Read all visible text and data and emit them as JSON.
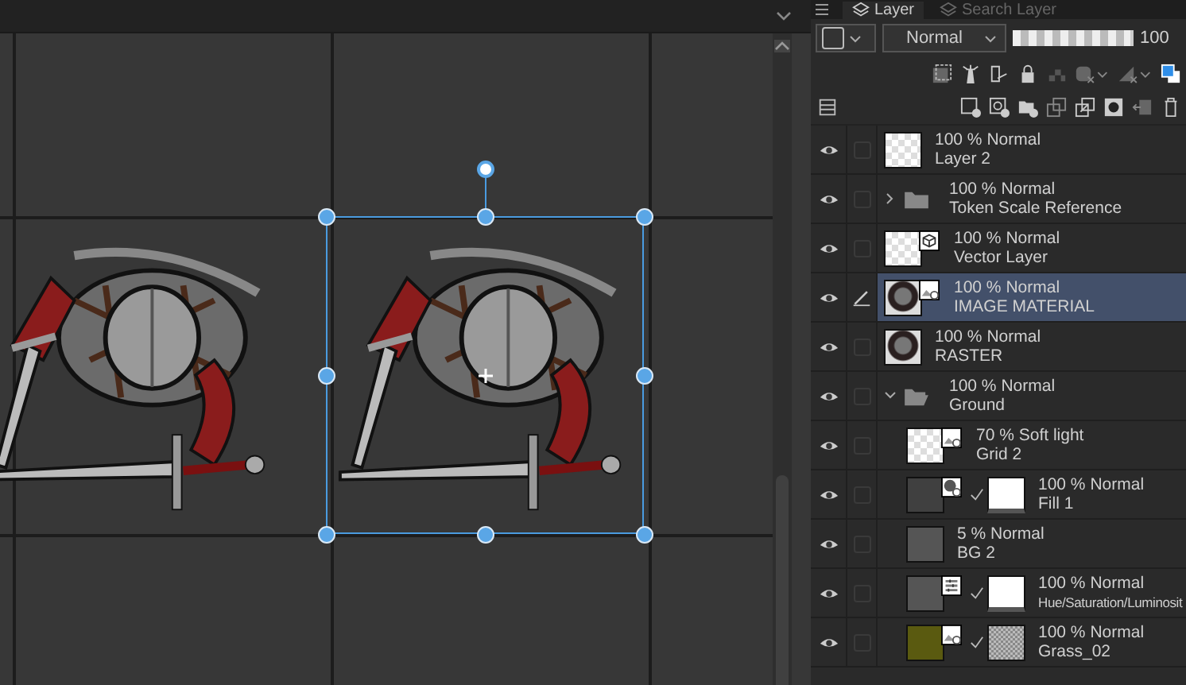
{
  "panel": {
    "tabs": [
      {
        "label": "Layer",
        "selected": true
      },
      {
        "label": "Search Layer",
        "selected": false
      }
    ],
    "blend_mode": "Normal",
    "opacity": {
      "level": 1.0,
      "reading": "100"
    },
    "layers": [
      {
        "kind": "raster",
        "thumb": {
          "kind": "checker"
        },
        "opacity_mode": "100 % Normal",
        "name": "Layer 2",
        "visible": true,
        "selected": false
      },
      {
        "kind": "folder",
        "opacity_mode": "100 % Normal",
        "name": "Token Scale Reference",
        "visible": true,
        "selected": false,
        "expanded": false
      },
      {
        "kind": "vector",
        "thumb": {
          "kind": "checker"
        },
        "opacity_mode": "100 % Normal",
        "name": "Vector Layer",
        "visible": true,
        "selected": false
      },
      {
        "kind": "material",
        "thumb": {
          "kind": "art"
        },
        "opacity_mode": "100 % Normal",
        "name": "IMAGE MATERIAL",
        "visible": true,
        "selected": true
      },
      {
        "kind": "raster",
        "thumb": {
          "kind": "art"
        },
        "opacity_mode": "100 % Normal",
        "name": "RASTER",
        "visible": true,
        "selected": false
      },
      {
        "kind": "folder",
        "opacity_mode": "100 % Normal",
        "name": "Ground",
        "visible": true,
        "selected": false,
        "expanded": true,
        "children": [
          {
            "kind": "material",
            "thumb": {
              "kind": "checker"
            },
            "opacity_mode": "70 % Soft light",
            "name": "Grid 2",
            "visible": true,
            "selected": false,
            "clipped": false
          },
          {
            "kind": "fill",
            "thumb": {
              "kind": "dark"
            },
            "mask": {
              "kind": "white"
            },
            "opacity_mode": "100 % Normal",
            "name": "Fill 1",
            "visible": true,
            "selected": false,
            "clipped": true
          },
          {
            "kind": "raster",
            "thumb": {
              "kind": "gray"
            },
            "opacity_mode": "5 % Normal",
            "name": "BG 2",
            "visible": true,
            "selected": false,
            "clipped": false
          },
          {
            "kind": "adjustment",
            "thumb": {
              "kind": "gray"
            },
            "mask": {
              "kind": "white"
            },
            "opacity_mode": "100 % Normal",
            "name": "Hue/Saturation/Luminosit",
            "visible": true,
            "selected": false,
            "clipped": true
          },
          {
            "kind": "material",
            "thumb": {
              "kind": "olive"
            },
            "mask": {
              "kind": "noise"
            },
            "opacity_mode": "100 % Normal",
            "name": "Grass_02",
            "visible": true,
            "selected": false,
            "clipped": true
          }
        ]
      }
    ]
  }
}
